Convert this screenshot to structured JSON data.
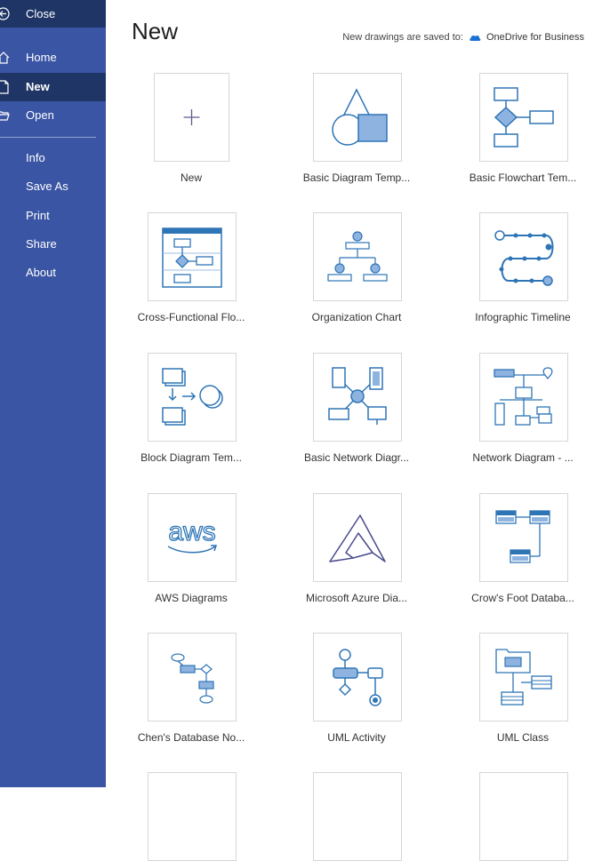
{
  "sidebar": {
    "close_label": "Close",
    "items": [
      {
        "label": "Home",
        "icon": "home-icon"
      },
      {
        "label": "New",
        "icon": "new-file-icon",
        "active": true
      },
      {
        "label": "Open",
        "icon": "folder-open-icon"
      }
    ],
    "secondary": [
      "Info",
      "Save As",
      "Print",
      "Share",
      "About"
    ]
  },
  "main": {
    "title": "New",
    "save_note": "New drawings are saved to:",
    "save_location": "OneDrive for Business"
  },
  "templates": [
    {
      "label": "New"
    },
    {
      "label": "Basic Diagram Temp..."
    },
    {
      "label": "Basic Flowchart Tem..."
    },
    {
      "label": "Cross-Functional Flo..."
    },
    {
      "label": "Organization Chart"
    },
    {
      "label": "Infographic Timeline"
    },
    {
      "label": "Block Diagram Tem..."
    },
    {
      "label": "Basic Network Diagr..."
    },
    {
      "label": "Network Diagram - ..."
    },
    {
      "label": "AWS Diagrams",
      "thumb_text": "aws"
    },
    {
      "label": "Microsoft Azure Dia..."
    },
    {
      "label": "Crow's Foot Databa..."
    },
    {
      "label": "Chen's Database No..."
    },
    {
      "label": "UML Activity"
    },
    {
      "label": "UML Class"
    }
  ],
  "colors": {
    "sidebar": "#3a55a4",
    "sidebar_dark": "#1f3566",
    "accent": "#2e75b6",
    "fill": "#8fb3e0"
  }
}
